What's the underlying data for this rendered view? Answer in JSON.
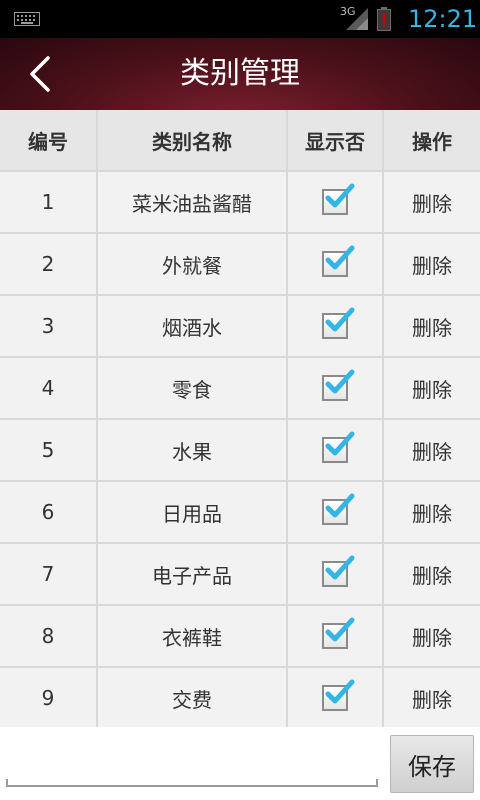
{
  "status_bar": {
    "network": "3G",
    "time": "12:21",
    "icons": [
      "keyboard-icon",
      "signal-icon",
      "battery-alert-icon"
    ]
  },
  "header": {
    "title": "类别管理",
    "back_icon": "chevron-left-icon"
  },
  "table": {
    "columns": [
      "编号",
      "类别名称",
      "显示否",
      "操作"
    ],
    "rows": [
      {
        "id": "1",
        "name": "菜米油盐酱醋",
        "show": true,
        "action": "删除"
      },
      {
        "id": "2",
        "name": "外就餐",
        "show": true,
        "action": "删除"
      },
      {
        "id": "3",
        "name": "烟酒水",
        "show": true,
        "action": "删除"
      },
      {
        "id": "4",
        "name": "零食",
        "show": true,
        "action": "删除"
      },
      {
        "id": "5",
        "name": "水果",
        "show": true,
        "action": "删除"
      },
      {
        "id": "6",
        "name": "日用品",
        "show": true,
        "action": "删除"
      },
      {
        "id": "7",
        "name": "电子产品",
        "show": true,
        "action": "删除"
      },
      {
        "id": "8",
        "name": "衣裤鞋",
        "show": true,
        "action": "删除"
      },
      {
        "id": "9",
        "name": "交费",
        "show": true,
        "action": "删除"
      },
      {
        "id": "",
        "name": "",
        "show": true,
        "action": ""
      }
    ]
  },
  "bottom": {
    "input_value": "",
    "input_placeholder": "",
    "save_label": "保存"
  },
  "colors": {
    "accent": "#33b5e5",
    "header_bg": "#4a1019",
    "check": "#33b5e5"
  }
}
